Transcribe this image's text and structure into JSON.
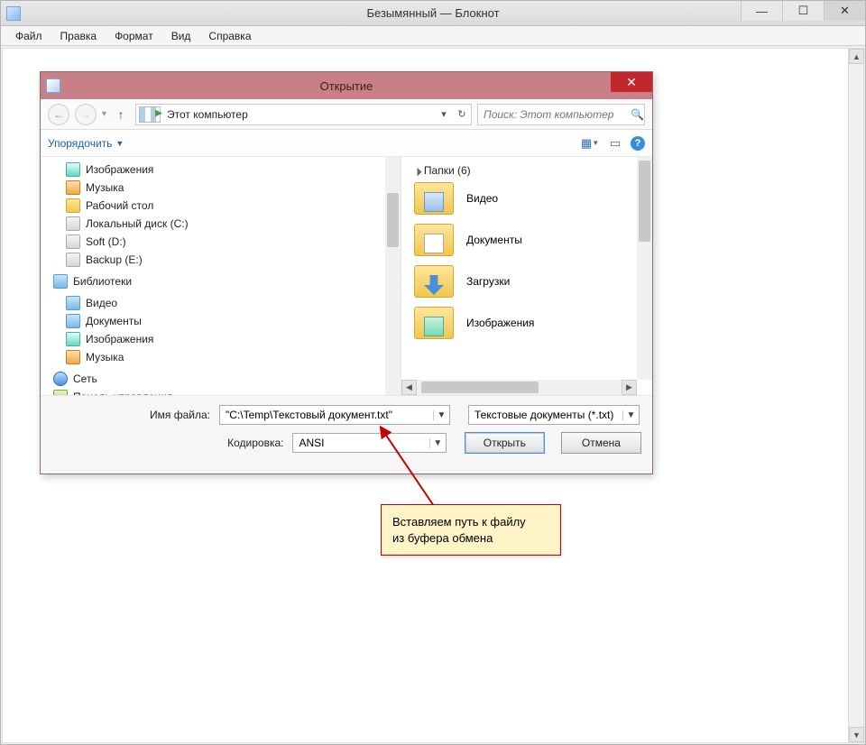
{
  "window": {
    "title": "Безымянный — Блокнот"
  },
  "menubar": {
    "file": "Файл",
    "edit": "Правка",
    "format": "Формат",
    "view": "Вид",
    "help": "Справка"
  },
  "dialog": {
    "title": "Открытие",
    "address": "Этот компьютер",
    "search_placeholder": "Поиск: Этот компьютер",
    "organize": "Упорядочить",
    "tree": {
      "pictures": "Изображения",
      "music": "Музыка",
      "desktop": "Рабочий стол",
      "drive_c": "Локальный диск (C:)",
      "drive_d": "Soft (D:)",
      "drive_e": "Backup (E:)",
      "libraries": "Библиотеки",
      "lib_video": "Видео",
      "lib_docs": "Документы",
      "lib_pics": "Изображения",
      "lib_music": "Музыка",
      "network": "Сеть",
      "control_panel": "Панель управления"
    },
    "content": {
      "section": "Папки (6)",
      "video": "Видео",
      "documents": "Документы",
      "downloads": "Загрузки",
      "pictures": "Изображения"
    },
    "labels": {
      "filename": "Имя файла:",
      "encoding": "Кодировка:"
    },
    "values": {
      "filename": "\"C:\\Temp\\Текстовый документ.txt\"",
      "filter": "Текстовые документы (*.txt)",
      "encoding": "ANSI"
    },
    "buttons": {
      "open": "Открыть",
      "cancel": "Отмена"
    }
  },
  "annotation": {
    "line1": "Вставляем путь к файлу",
    "line2": "из буфера обмена"
  }
}
